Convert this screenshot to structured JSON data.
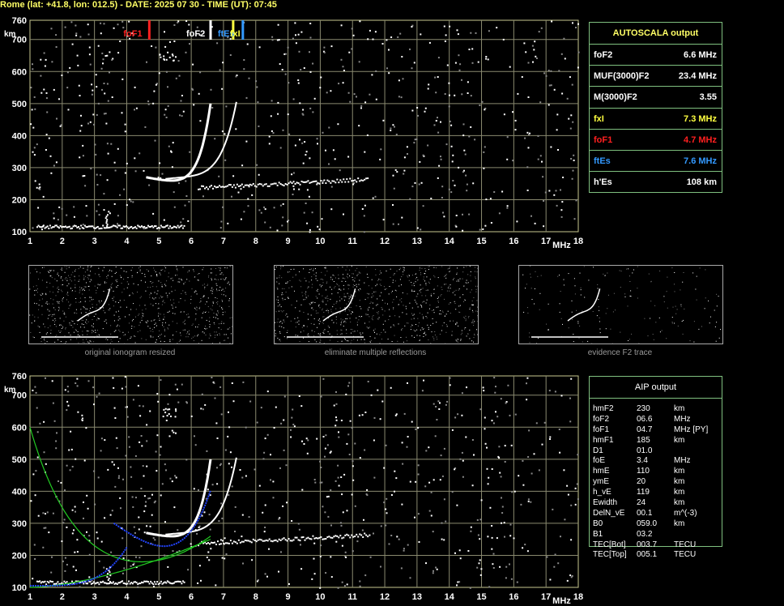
{
  "header": {
    "title": "Rome (lat: +41.8, lon: 012.5) - DATE: 2025 07 30 - TIME (UT): 07:45"
  },
  "axes": {
    "y_unit": "km",
    "x_unit": "MHz",
    "y_ticks": [
      "760",
      "700",
      "600",
      "500",
      "400",
      "300",
      "200",
      "100"
    ],
    "x_ticks": [
      "1",
      "2",
      "3",
      "4",
      "5",
      "6",
      "7",
      "8",
      "9",
      "10",
      "11",
      "12",
      "13",
      "14",
      "15",
      "16",
      "17",
      "18"
    ]
  },
  "markers": [
    {
      "label": "foF1",
      "freq_mhz": 4.7,
      "color": "#ff2020"
    },
    {
      "label": "foF2",
      "freq_mhz": 6.6,
      "color": "#ffffff"
    },
    {
      "label": "fxI",
      "freq_mhz": 7.3,
      "color": "#ffff40"
    },
    {
      "label": "ftEs",
      "freq_mhz": 7.6,
      "color": "#3399ff"
    }
  ],
  "autoscala": {
    "title": "AUTOSCALA output",
    "rows": [
      {
        "name": "foF2",
        "value": "6.6 MHz",
        "color": "#ffffff"
      },
      {
        "name": "MUF(3000)F2",
        "value": "23.4 MHz",
        "color": "#ffffff"
      },
      {
        "name": "M(3000)F2",
        "value": "3.55",
        "color": "#ffffff"
      },
      {
        "name": "fxI",
        "value": "7.3 MHz",
        "color": "#ffff40"
      },
      {
        "name": "foF1",
        "value": "4.7 MHz",
        "color": "#ff2020"
      },
      {
        "name": "ftEs",
        "value": "7.6 MHz",
        "color": "#3399ff"
      },
      {
        "name": "h'Es",
        "value": "108    km",
        "color": "#ffffff"
      }
    ]
  },
  "thumbnails": [
    {
      "caption": "original ionogram resized"
    },
    {
      "caption": "eliminate multiple reflections"
    },
    {
      "caption": "evidence F2 trace"
    }
  ],
  "aip": {
    "title": "AIP output",
    "rows": [
      {
        "name": "hmF2",
        "value": "230",
        "unit": "km"
      },
      {
        "name": "foF2",
        "value": "06.6",
        "unit": "MHz"
      },
      {
        "name": "foF1",
        "value": "04.7",
        "unit": "MHz   [PY]"
      },
      {
        "name": "hmF1",
        "value": "185",
        "unit": "km"
      },
      {
        "name": "D1",
        "value": "01.0",
        "unit": ""
      },
      {
        "name": "foE",
        "value": "3.4",
        "unit": "MHz"
      },
      {
        "name": "hmE",
        "value": "110",
        "unit": "km"
      },
      {
        "name": "ymE",
        "value": "20",
        "unit": "km"
      },
      {
        "name": "h_vE",
        "value": "119",
        "unit": "km"
      },
      {
        "name": "Ewidth",
        "value": "24",
        "unit": "km"
      },
      {
        "name": "DelN_vE",
        "value": "00.1",
        "unit": "m^(-3)"
      },
      {
        "name": "B0",
        "value": "059.0",
        "unit": "km"
      },
      {
        "name": "B1",
        "value": "03.2",
        "unit": ""
      },
      {
        "name": "TEC[Bot]",
        "value": "003.7",
        "unit": "TECU"
      },
      {
        "name": "TEC[Top]",
        "value": "005.1",
        "unit": "TECU"
      }
    ]
  },
  "colors": {
    "grid": "#8a8a70",
    "frame": "#c8c890",
    "table_border": "#7fc07f",
    "profile_green": "#22cc22",
    "profile_blue": "#2244ff"
  }
}
